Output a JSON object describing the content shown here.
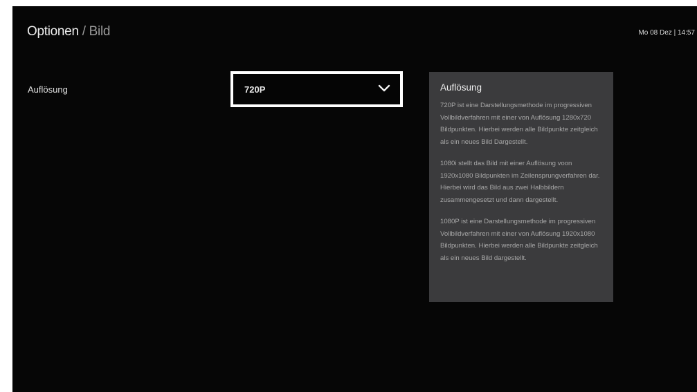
{
  "header": {
    "title": "Optionen",
    "separator": " / ",
    "subtitle": "Bild",
    "clock": "Mo 08 Dez | 14:57"
  },
  "setting": {
    "label": "Auflösung",
    "selected_value": "720P",
    "chevron_icon": "chevron-down-icon"
  },
  "info_panel": {
    "title": "Auflösung",
    "paragraphs": [
      "720P ist eine Darstellungsmethode im progressiven Vollbildverfahren mit einer von Auflösung 1280x720 Bildpunkten. Hierbei werden alle Bildpunkte zeitgleich als ein neues Bild Dargestellt.",
      "1080i stellt das Bild mit einer Auflösung voon 1920x1080 Bildpunkten im Zeilensprungverfahren dar. Hierbei wird das Bild aus zwei Halbbildern zusammengesetzt und dann dargestellt.",
      "1080P ist eine Darstellungsmethode im progressiven Vollbildverfahren mit einer von Auflösung 1920x1080 Bildpunkten. Hierbei werden alle Bildpunkte zeitgleich als ein neues Bild dargestellt."
    ]
  },
  "colors": {
    "background": "#060606",
    "panel": "#3b3b3d",
    "focus_border": "#ffffff"
  }
}
